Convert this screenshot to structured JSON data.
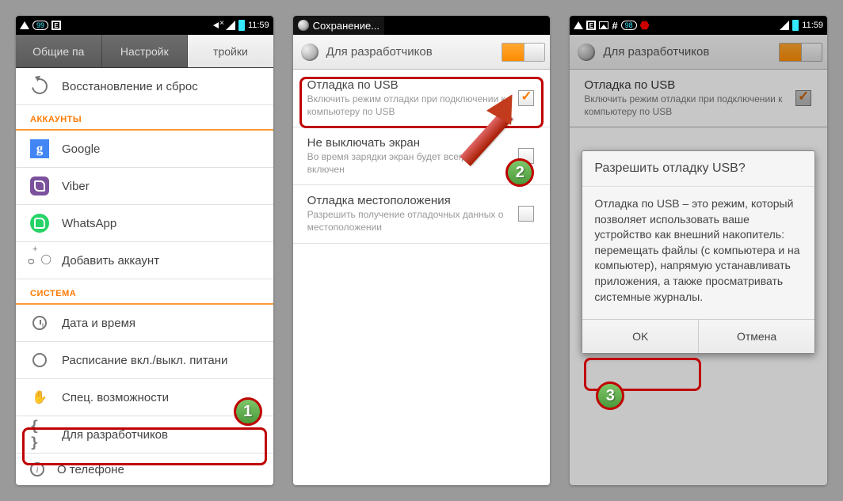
{
  "status_time": "11:59",
  "badge1": "99",
  "badge2": "98",
  "tabs": [
    "Общие па",
    "Настройк",
    "тройки"
  ],
  "s1": {
    "restore": "Восстановление и сброс",
    "sec_accounts": "АККАУНТЫ",
    "google": "Google",
    "viber": "Viber",
    "whatsapp": "WhatsApp",
    "add_account": "Добавить аккаунт",
    "sec_system": "СИСТЕМА",
    "datetime": "Дата и время",
    "schedule": "Расписание вкл./выкл. питани",
    "access": "Спец. возможности",
    "dev": "Для разработчиков",
    "about": "О телефоне"
  },
  "s2": {
    "saving": "Сохранение...",
    "title": "Для разработчиков",
    "usb_t": "Отладка по USB",
    "usb_d": "Включить режим отладки при подключении к компьютеру по USB",
    "stay_t": "Не выключать экран",
    "stay_d": "Во время зарядки экран будет всегда включен",
    "loc_t": "Отладка местоположения",
    "loc_d": "Разрешить получение отладочных данных о местоположении"
  },
  "s3": {
    "title": "Для разработчиков",
    "dlg_title": "Разрешить отладку USB?",
    "dlg_body": "Отладка по USB – это режим, который позволяет использовать ваше устройство как внешний накопитель: перемещать файлы (с компьютера и на компьютер), напрямую устанавливать приложения, а также просматривать системные журналы.",
    "ok": "OK",
    "cancel": "Отмена"
  },
  "markers": {
    "m1": "1",
    "m2": "2",
    "m3": "3"
  }
}
